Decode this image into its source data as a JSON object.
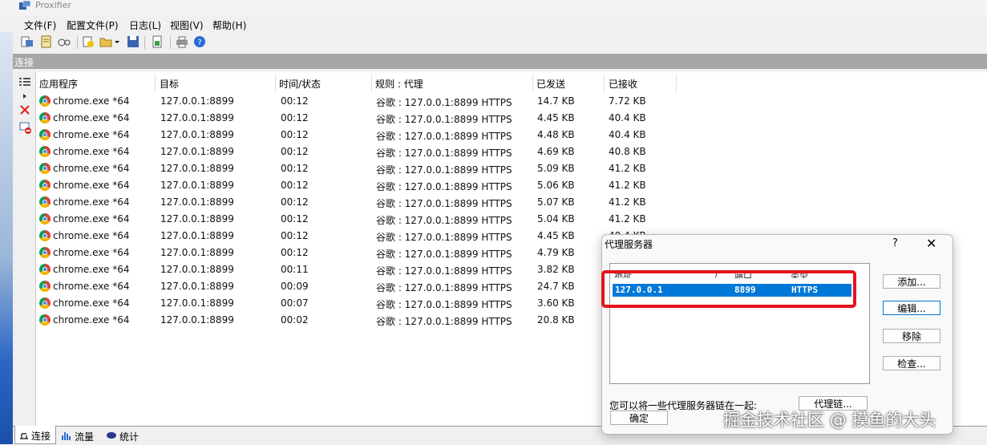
{
  "window": {
    "title": "Proxifier"
  },
  "menu": [
    "文件(F)",
    "配置文件(P)",
    "日志(L)",
    "视图(V)",
    "帮助(H)"
  ],
  "toolbar_icons": [
    "new-profile-icon",
    "edit-profile-icon",
    "proxy-servers-icon",
    "proxification-rules-icon",
    "open-profile-icon",
    "dropdown-arrow-icon",
    "save-profile-icon",
    "import-icon",
    "print-icon",
    "help-icon"
  ],
  "section": {
    "label": "连接"
  },
  "columns": [
    "应用程序",
    "目标",
    "时间/状态",
    "规则 : 代理",
    "已发送",
    "已接收"
  ],
  "rows": [
    {
      "app": "chrome.exe *64",
      "target": "127.0.0.1:8899",
      "time": "00:12",
      "rule": "谷歌 : 127.0.0.1:8899 HTTPS",
      "sent": "14.7 KB",
      "recv": "7.72 KB"
    },
    {
      "app": "chrome.exe *64",
      "target": "127.0.0.1:8899",
      "time": "00:12",
      "rule": "谷歌 : 127.0.0.1:8899 HTTPS",
      "sent": "4.45 KB",
      "recv": "40.4 KB"
    },
    {
      "app": "chrome.exe *64",
      "target": "127.0.0.1:8899",
      "time": "00:12",
      "rule": "谷歌 : 127.0.0.1:8899 HTTPS",
      "sent": "4.48 KB",
      "recv": "40.4 KB"
    },
    {
      "app": "chrome.exe *64",
      "target": "127.0.0.1:8899",
      "time": "00:12",
      "rule": "谷歌 : 127.0.0.1:8899 HTTPS",
      "sent": "4.69 KB",
      "recv": "40.8 KB"
    },
    {
      "app": "chrome.exe *64",
      "target": "127.0.0.1:8899",
      "time": "00:12",
      "rule": "谷歌 : 127.0.0.1:8899 HTTPS",
      "sent": "5.09 KB",
      "recv": "41.2 KB"
    },
    {
      "app": "chrome.exe *64",
      "target": "127.0.0.1:8899",
      "time": "00:12",
      "rule": "谷歌 : 127.0.0.1:8899 HTTPS",
      "sent": "5.06 KB",
      "recv": "41.2 KB"
    },
    {
      "app": "chrome.exe *64",
      "target": "127.0.0.1:8899",
      "time": "00:12",
      "rule": "谷歌 : 127.0.0.1:8899 HTTPS",
      "sent": "5.07 KB",
      "recv": "41.2 KB"
    },
    {
      "app": "chrome.exe *64",
      "target": "127.0.0.1:8899",
      "time": "00:12",
      "rule": "谷歌 : 127.0.0.1:8899 HTTPS",
      "sent": "5.04 KB",
      "recv": "41.2 KB"
    },
    {
      "app": "chrome.exe *64",
      "target": "127.0.0.1:8899",
      "time": "00:12",
      "rule": "谷歌 : 127.0.0.1:8899 HTTPS",
      "sent": "4.45 KB",
      "recv": "40.4 KB"
    },
    {
      "app": "chrome.exe *64",
      "target": "127.0.0.1:8899",
      "time": "00:12",
      "rule": "谷歌 : 127.0.0.1:8899 HTTPS",
      "sent": "4.79 KB",
      "recv": ""
    },
    {
      "app": "chrome.exe *64",
      "target": "127.0.0.1:8899",
      "time": "00:11",
      "rule": "谷歌 : 127.0.0.1:8899 HTTPS",
      "sent": "3.82 KB",
      "recv": ""
    },
    {
      "app": "chrome.exe *64",
      "target": "127.0.0.1:8899",
      "time": "00:09",
      "rule": "谷歌 : 127.0.0.1:8899 HTTPS",
      "sent": "24.7 KB",
      "recv": ""
    },
    {
      "app": "chrome.exe *64",
      "target": "127.0.0.1:8899",
      "time": "00:07",
      "rule": "谷歌 : 127.0.0.1:8899 HTTPS",
      "sent": "3.60 KB",
      "recv": ""
    },
    {
      "app": "chrome.exe *64",
      "target": "127.0.0.1:8899",
      "time": "00:02",
      "rule": "谷歌 : 127.0.0.1:8899 HTTPS",
      "sent": "20.8 KB",
      "recv": ""
    }
  ],
  "bottom_tabs": [
    "连接",
    "流量",
    "统计"
  ],
  "dialog": {
    "title": "代理服务器",
    "help": "?",
    "close": "✕",
    "list_headers": {
      "address": "地址",
      "sort": "/",
      "port": "端口",
      "type": "类型"
    },
    "selected_server": {
      "address": "127.0.0.1",
      "port": "8899",
      "type": "HTTPS"
    },
    "buttons": {
      "add": "添加...",
      "edit": "编辑...",
      "remove": "移除",
      "check": "检查..."
    },
    "chain_text": "您可以将一些代理服务器链在一起:",
    "chain_button": "代理链...",
    "ok_button": "确定"
  },
  "watermark": "掘金技术社区 @ 摸鱼的大头",
  "colors": {
    "selection": "#0078d7",
    "highlight_box": "#e3141e",
    "section_header": "#a7a7a7"
  }
}
